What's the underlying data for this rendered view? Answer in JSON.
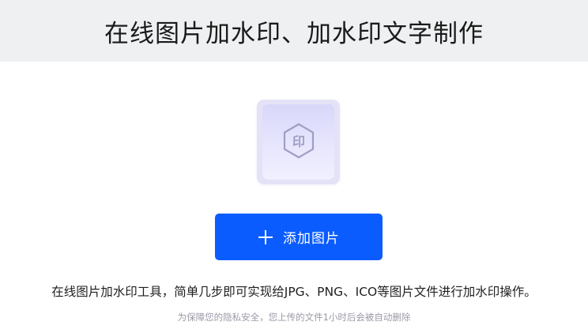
{
  "header": {
    "title": "在线图片加水印、加水印文字制作"
  },
  "upload": {
    "icon": "watermark-stamp-icon",
    "icon_text": "印",
    "button_label": "添加图片",
    "button_icon": "plus-icon"
  },
  "info": {
    "description": "在线图片加水印工具，简单几步即可实现给JPG、PNG、ICO等图片文件进行加水印操作。",
    "privacy_note": "为保障您的隐私安全，您上传的文件1小时后会被自动删除"
  },
  "colors": {
    "header_bg": "#eef0f1",
    "accent": "#0a5cff",
    "tile_bg": "#e4e2f6",
    "icon_stroke": "#9f9ec4"
  }
}
